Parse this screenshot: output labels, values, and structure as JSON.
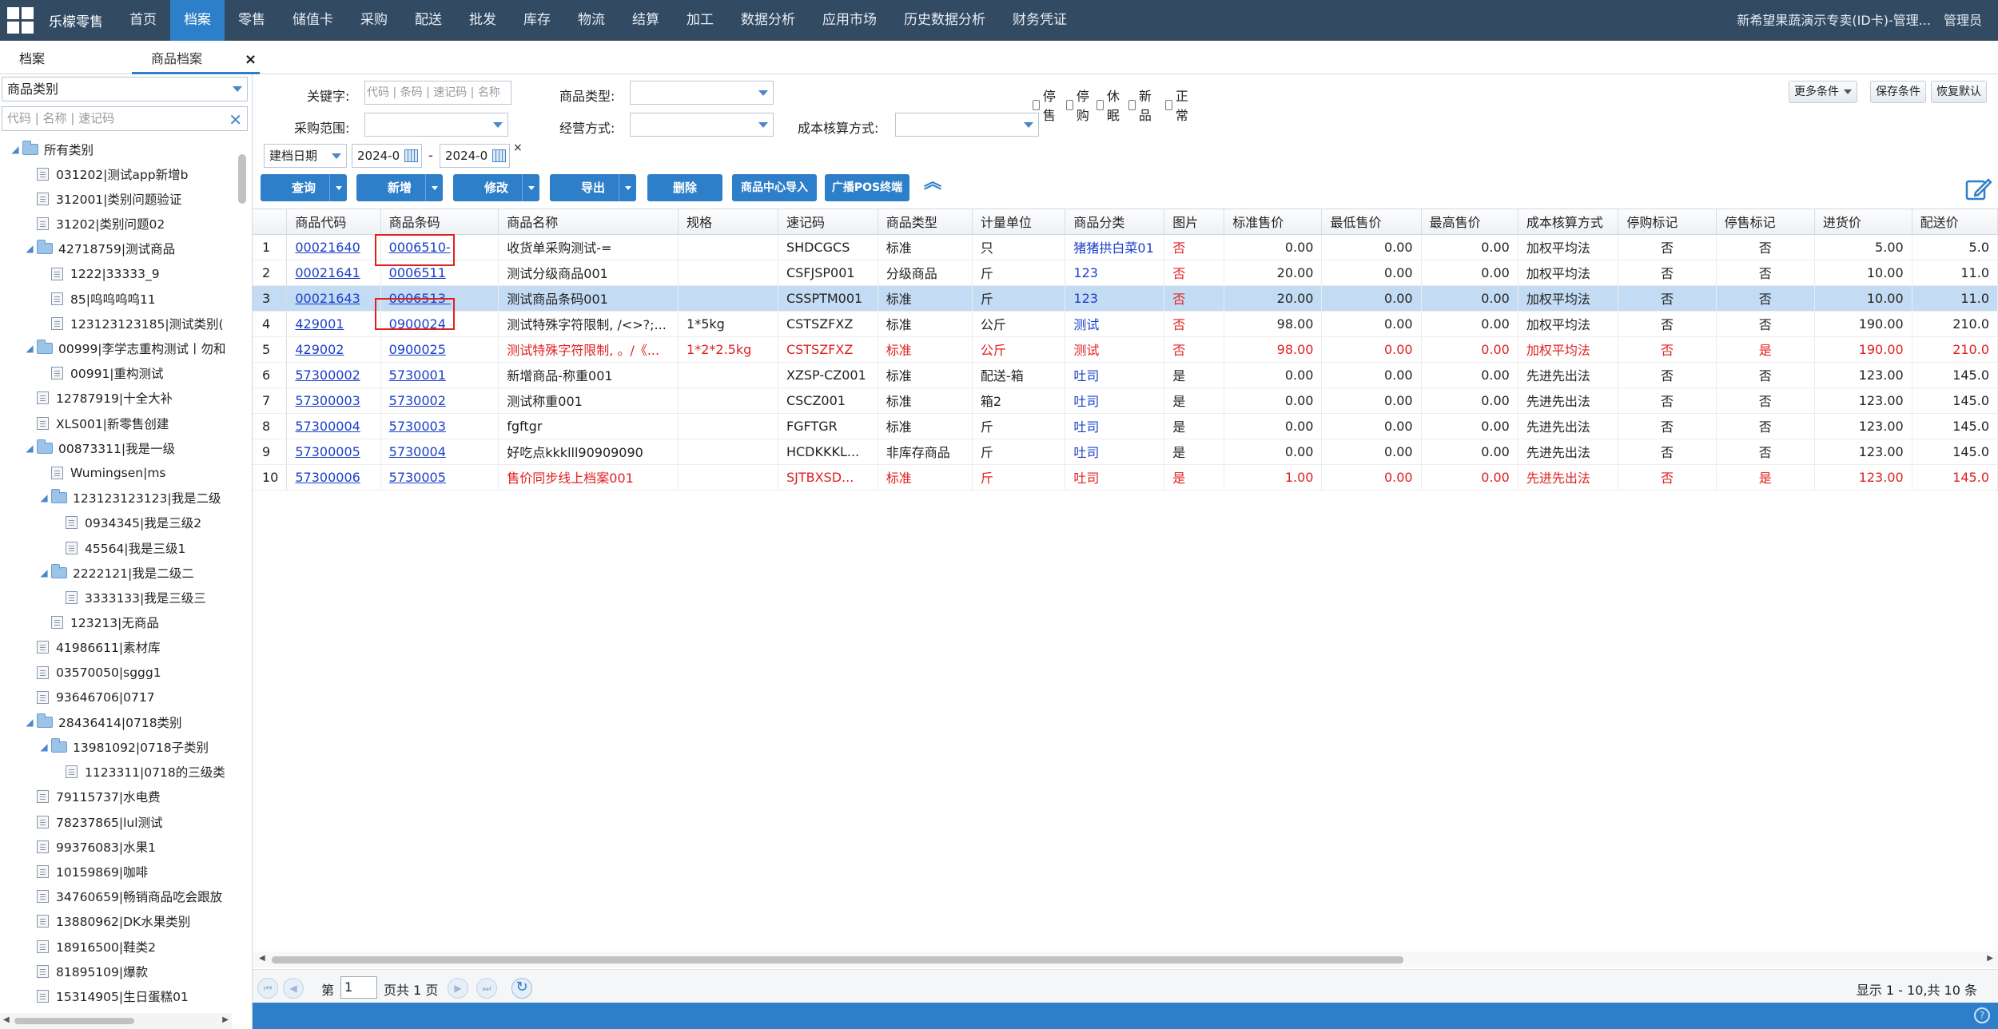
{
  "topbar": {
    "brand": "乐檬零售",
    "nav": [
      "首页",
      "档案",
      "零售",
      "储值卡",
      "采购",
      "配送",
      "批发",
      "库存",
      "物流",
      "结算",
      "加工",
      "数据分析",
      "应用市场",
      "历史数据分析",
      "财务凭证"
    ],
    "active": "档案",
    "store": "新希望果蔬演示专卖(ID卡)-管理...",
    "user": "管理员"
  },
  "tabs": {
    "tab1": "档案",
    "tab2": "商品档案",
    "close": "×"
  },
  "sidebar": {
    "category_select": "商品类别",
    "search_placeholder": "代码 | 名称 | 速记码",
    "tree": [
      {
        "label": "所有类别",
        "level": 0,
        "type": "folder"
      },
      {
        "label": "031202|测试app新增b",
        "level": 1,
        "type": "leaf"
      },
      {
        "label": "312001|类别问题验证",
        "level": 1,
        "type": "leaf"
      },
      {
        "label": "31202|类别问题02",
        "level": 1,
        "type": "leaf"
      },
      {
        "label": "42718759|测试商品",
        "level": 1,
        "type": "folder"
      },
      {
        "label": "1222|33333_9",
        "level": 2,
        "type": "leaf"
      },
      {
        "label": "85|呜呜呜呜11",
        "level": 2,
        "type": "leaf"
      },
      {
        "label": "123123123185|测试类别(",
        "level": 2,
        "type": "leaf"
      },
      {
        "label": "00999|李学志重构测试丨勿和",
        "level": 1,
        "type": "folder"
      },
      {
        "label": "00991|重构测试",
        "level": 2,
        "type": "leaf"
      },
      {
        "label": "12787919|十全大补",
        "level": 1,
        "type": "leaf"
      },
      {
        "label": "XLS001|新零售创建",
        "level": 1,
        "type": "leaf"
      },
      {
        "label": "00873311|我是一级",
        "level": 1,
        "type": "folder"
      },
      {
        "label": "Wumingsen|ms",
        "level": 2,
        "type": "leaf"
      },
      {
        "label": "123123123123|我是二级",
        "level": 2,
        "type": "folder"
      },
      {
        "label": "0934345|我是三级2",
        "level": 3,
        "type": "leaf"
      },
      {
        "label": "45564|我是三级1",
        "level": 3,
        "type": "leaf"
      },
      {
        "label": "2222121|我是二级二",
        "level": 2,
        "type": "folder"
      },
      {
        "label": "3333133|我是三级三",
        "level": 3,
        "type": "leaf"
      },
      {
        "label": "123213|无商品",
        "level": 2,
        "type": "leaf"
      },
      {
        "label": "41986611|素材库",
        "level": 1,
        "type": "leaf"
      },
      {
        "label": "03570050|sggg1",
        "level": 1,
        "type": "leaf"
      },
      {
        "label": "93646706|0717",
        "level": 1,
        "type": "leaf"
      },
      {
        "label": "28436414|0718类别",
        "level": 1,
        "type": "folder"
      },
      {
        "label": "13981092|0718子类别",
        "level": 2,
        "type": "folder"
      },
      {
        "label": "1123311|0718的三级类",
        "level": 3,
        "type": "leaf"
      },
      {
        "label": "79115737|水电费",
        "level": 1,
        "type": "leaf"
      },
      {
        "label": "78237865|lul测试",
        "level": 1,
        "type": "leaf"
      },
      {
        "label": "99376083|水果1",
        "level": 1,
        "type": "leaf"
      },
      {
        "label": "10159869|咖啡",
        "level": 1,
        "type": "leaf"
      },
      {
        "label": "34760659|畅销商品吃会跟放",
        "level": 1,
        "type": "leaf"
      },
      {
        "label": "13880962|DK水果类别",
        "level": 1,
        "type": "leaf"
      },
      {
        "label": "18916500|鞋类2",
        "level": 1,
        "type": "leaf"
      },
      {
        "label": "81895109|爆款",
        "level": 1,
        "type": "leaf"
      },
      {
        "label": "15314905|生日蛋糕01",
        "level": 1,
        "type": "leaf"
      }
    ]
  },
  "filters": {
    "keyword_label": "关键字:",
    "keyword_placeholder": "代码 | 条码 | 速记码 | 名称",
    "type_label": "商品类型:",
    "purchase_label": "采购范围:",
    "operate_label": "经营方式:",
    "cost_label": "成本核算方式:",
    "checks": [
      "停售",
      "停购",
      "休眠",
      "新品",
      "正常"
    ],
    "date_type": "建档日期",
    "date_from": "2024-0",
    "date_to": "2024-0",
    "date_sep": "-",
    "date_clear": "×",
    "more": "更多条件",
    "save": "保存条件",
    "restore": "恢复默认"
  },
  "buttons": {
    "query": "查询",
    "add": "新增",
    "edit": "修改",
    "export": "导出",
    "delete": "删除",
    "import": "商品中心导入",
    "broadcast": "广播POS终端"
  },
  "table": {
    "columns": [
      "",
      "商品代码",
      "商品条码",
      "商品名称",
      "规格",
      "速记码",
      "商品类型",
      "计量单位",
      "商品分类",
      "图片",
      "标准售价",
      "最低售价",
      "最高售价",
      "成本核算方式",
      "停购标记",
      "停售标记",
      "进货价",
      "配送价"
    ],
    "rows": [
      {
        "n": "1",
        "code": "00021640",
        "barcode": "0006510-",
        "name": "收货单采购测试-=",
        "spec": "",
        "short": "SHDCGCS",
        "type": "标准",
        "unit": "只",
        "cat": "猪猪拱白菜01",
        "pic": "否",
        "std": "0.00",
        "min": "0.00",
        "max": "0.00",
        "cost": "加权平均法",
        "stop_buy": "否",
        "stop_sell": "否",
        "buy": "5.00",
        "dist": "5.0"
      },
      {
        "n": "2",
        "code": "00021641",
        "barcode": "0006511",
        "name": "测试分级商品001",
        "spec": "",
        "short": "CSFJSP001",
        "type": "分级商品",
        "unit": "斤",
        "cat": "123",
        "pic": "否",
        "std": "20.00",
        "min": "0.00",
        "max": "0.00",
        "cost": "加权平均法",
        "stop_buy": "否",
        "stop_sell": "否",
        "buy": "10.00",
        "dist": "11.0"
      },
      {
        "n": "3",
        "code": "00021643",
        "barcode": "0006513-",
        "name": "测试商品条码001",
        "spec": "",
        "short": "CSSPTM001",
        "type": "标准",
        "unit": "斤",
        "cat": "123",
        "pic": "否",
        "std": "20.00",
        "min": "0.00",
        "max": "0.00",
        "cost": "加权平均法",
        "stop_buy": "否",
        "stop_sell": "否",
        "buy": "10.00",
        "dist": "11.0"
      },
      {
        "n": "4",
        "code": "429001",
        "barcode": "0900024",
        "name": "测试特殊字符限制, /<>?;...",
        "spec": "1*5kg",
        "short": "CSTSZFXZ",
        "type": "标准",
        "unit": "公斤",
        "cat": "测试",
        "pic": "否",
        "std": "98.00",
        "min": "0.00",
        "max": "0.00",
        "cost": "加权平均法",
        "stop_buy": "否",
        "stop_sell": "否",
        "buy": "190.00",
        "dist": "210.0"
      },
      {
        "n": "5",
        "code": "429002",
        "barcode": "0900025",
        "name": "测试特殊字符限制, 。/《...",
        "spec": "1*2*2.5kg",
        "short": "CSTSZFXZ",
        "type": "标准",
        "unit": "公斤",
        "cat": "测试",
        "pic": "否",
        "std": "98.00",
        "min": "0.00",
        "max": "0.00",
        "cost": "加权平均法",
        "stop_buy": "否",
        "stop_sell": "是",
        "buy": "190.00",
        "dist": "210.0"
      },
      {
        "n": "6",
        "code": "57300002",
        "barcode": "5730001",
        "name": "新增商品-称重001",
        "spec": "",
        "short": "XZSP-CZ001",
        "type": "标准",
        "unit": "配送-箱",
        "cat": "吐司",
        "pic": "是",
        "std": "0.00",
        "min": "0.00",
        "max": "0.00",
        "cost": "先进先出法",
        "stop_buy": "否",
        "stop_sell": "否",
        "buy": "123.00",
        "dist": "145.0"
      },
      {
        "n": "7",
        "code": "57300003",
        "barcode": "5730002",
        "name": "测试称重001",
        "spec": "",
        "short": "CSCZ001",
        "type": "标准",
        "unit": "箱2",
        "cat": "吐司",
        "pic": "是",
        "std": "0.00",
        "min": "0.00",
        "max": "0.00",
        "cost": "先进先出法",
        "stop_buy": "否",
        "stop_sell": "否",
        "buy": "123.00",
        "dist": "145.0"
      },
      {
        "n": "8",
        "code": "57300004",
        "barcode": "5730003",
        "name": "fgftgr",
        "spec": "",
        "short": "FGFTGR",
        "type": "标准",
        "unit": "斤",
        "cat": "吐司",
        "pic": "是",
        "std": "0.00",
        "min": "0.00",
        "max": "0.00",
        "cost": "先进先出法",
        "stop_buy": "否",
        "stop_sell": "否",
        "buy": "123.00",
        "dist": "145.0"
      },
      {
        "n": "9",
        "code": "57300005",
        "barcode": "5730004",
        "name": "好吃点kkklll90909090",
        "spec": "",
        "short": "HCDKKKL...",
        "type": "非库存商品",
        "unit": "斤",
        "cat": "吐司",
        "pic": "是",
        "std": "0.00",
        "min": "0.00",
        "max": "0.00",
        "cost": "先进先出法",
        "stop_buy": "否",
        "stop_sell": "否",
        "buy": "123.00",
        "dist": "145.0"
      },
      {
        "n": "10",
        "code": "57300006",
        "barcode": "5730005",
        "name": "售价同步线上档案001",
        "spec": "",
        "short": "SJTBXSD...",
        "type": "标准",
        "unit": "斤",
        "cat": "吐司",
        "pic": "是",
        "std": "1.00",
        "min": "0.00",
        "max": "0.00",
        "cost": "先进先出法",
        "stop_buy": "否",
        "stop_sell": "是",
        "buy": "123.00",
        "dist": "145.0"
      }
    ]
  },
  "pager": {
    "page_label": "第",
    "page_value": "1",
    "page_total": "页共 1 页",
    "info": "显示 1 - 10,共 10 条"
  }
}
